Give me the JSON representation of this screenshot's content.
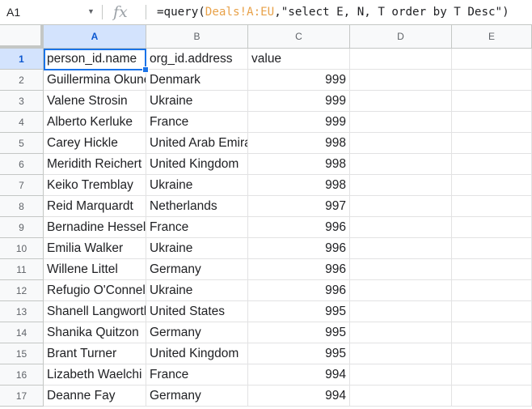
{
  "formula_bar": {
    "cell_ref": "A1",
    "fx_label": "fx",
    "formula_prefix": "=query(",
    "formula_ref": "Deals!A:EU",
    "formula_suffix": ",\"select E, N, T order by T Desc\")"
  },
  "columns": [
    "A",
    "B",
    "C",
    "D",
    "E"
  ],
  "rows": [
    {
      "num": "1",
      "name": "person_id.name",
      "country": "org_id.address",
      "value": "value"
    },
    {
      "num": "2",
      "name": "Guillermina Okuneva",
      "country": "Denmark",
      "value": "999"
    },
    {
      "num": "3",
      "name": "Valene Strosin",
      "country": "Ukraine",
      "value": "999"
    },
    {
      "num": "4",
      "name": "Alberto Kerluke",
      "country": "France",
      "value": "999"
    },
    {
      "num": "5",
      "name": "Carey Hickle",
      "country": "United Arab Emirates",
      "value": "998"
    },
    {
      "num": "6",
      "name": "Meridith Reichert",
      "country": "United Kingdom",
      "value": "998"
    },
    {
      "num": "7",
      "name": "Keiko Tremblay",
      "country": "Ukraine",
      "value": "998"
    },
    {
      "num": "8",
      "name": "Reid Marquardt",
      "country": "Netherlands",
      "value": "997"
    },
    {
      "num": "9",
      "name": "Bernadine Hessel",
      "country": "France",
      "value": "996"
    },
    {
      "num": "10",
      "name": "Emilia Walker",
      "country": "Ukraine",
      "value": "996"
    },
    {
      "num": "11",
      "name": "Willene Littel",
      "country": "Germany",
      "value": "996"
    },
    {
      "num": "12",
      "name": "Refugio O'Connell",
      "country": "Ukraine",
      "value": "996"
    },
    {
      "num": "13",
      "name": "Shanell Langworth",
      "country": "United States",
      "value": "995"
    },
    {
      "num": "14",
      "name": "Shanika Quitzon",
      "country": "Germany",
      "value": "995"
    },
    {
      "num": "15",
      "name": "Brant Turner",
      "country": "United Kingdom",
      "value": "995"
    },
    {
      "num": "16",
      "name": "Lizabeth Waelchi",
      "country": "France",
      "value": "994"
    },
    {
      "num": "17",
      "name": "Deanne Fay",
      "country": "Germany",
      "value": "994"
    }
  ]
}
